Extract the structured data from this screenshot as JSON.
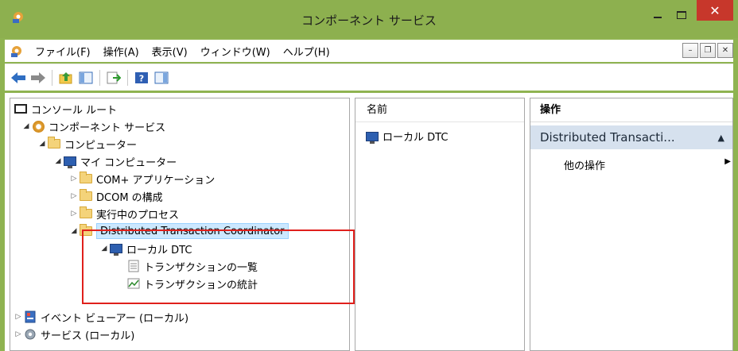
{
  "window": {
    "title": "コンポーネント サービス"
  },
  "menu": {
    "items": [
      "ファイル(F)",
      "操作(A)",
      "表示(V)",
      "ウィンドウ(W)",
      "ヘルプ(H)"
    ]
  },
  "toolbar": {
    "icons": [
      "back-arrow",
      "forward-arrow",
      "up-folder",
      "show-hide-tree",
      "export-list",
      "help",
      "properties-pane"
    ]
  },
  "tree": {
    "root": "コンソール ルート",
    "component_services": "コンポーネント サービス",
    "computers": "コンピューター",
    "my_computer": "マイ コンピューター",
    "com_apps": "COM+ アプリケーション",
    "dcom": "DCOM の構成",
    "running": "実行中のプロセス",
    "dtc": "Distributed Transaction Coordinator",
    "local_dtc": "ローカル DTC",
    "tx_list": "トランザクションの一覧",
    "tx_stats": "トランザクションの統計",
    "event_viewer": "イベント ビューアー (ローカル)",
    "services": "サービス (ローカル)"
  },
  "list": {
    "header": "名前",
    "items": [
      "ローカル DTC"
    ]
  },
  "actions": {
    "header": "操作",
    "section": "Distributed Transacti...",
    "more": "他の操作"
  },
  "colors": {
    "titlebar": "#8db04f",
    "close": "#c7372b",
    "highlight": "#e0201c",
    "selection": "#cce8ff",
    "action_section": "#d6e1ee"
  }
}
